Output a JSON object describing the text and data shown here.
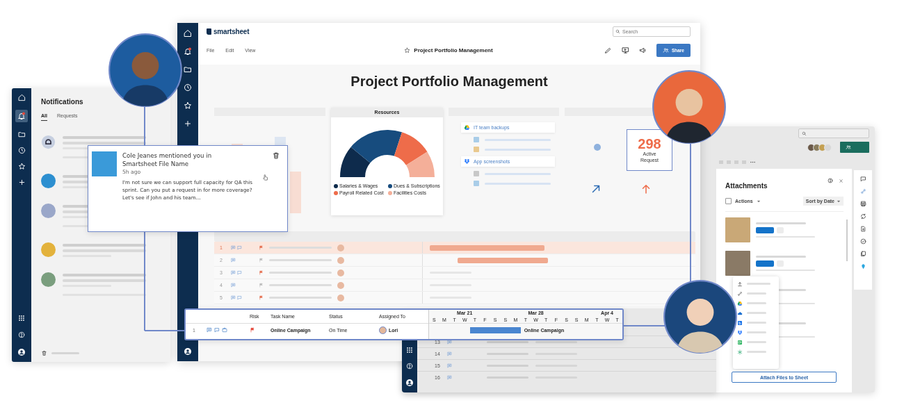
{
  "main": {
    "logo": "smartsheet",
    "search_placeholder": "Search",
    "menu": [
      "File",
      "Edit",
      "View"
    ],
    "sheet_title": "Project Portfolio Management",
    "share_button": "Share",
    "dashboard_title": "Project Portfolio Management",
    "resources": {
      "title": "Resources",
      "legend": [
        {
          "label": "Salaries & Wages",
          "color": "#0e2b4c"
        },
        {
          "label": "Dues & Subscriptions",
          "color": "#174c7e"
        },
        {
          "label": "Payroll Related Cost",
          "color": "#ee6c4a"
        },
        {
          "label": "Facilities Costs",
          "color": "#f4af99"
        }
      ]
    },
    "files": [
      {
        "kind": "gdrive",
        "label": "IT team backups"
      },
      {
        "kind": "dropbox",
        "label": "App screenshots"
      }
    ],
    "sheet_rows": [
      "1",
      "2",
      "3",
      "4",
      "5"
    ]
  },
  "metric": {
    "value": "298",
    "label": "Active Request"
  },
  "notifications": {
    "title": "Notifications",
    "tabs": [
      {
        "label": "All",
        "selected": true
      },
      {
        "label": "Requests",
        "selected": false
      }
    ]
  },
  "notification_card": {
    "title": "Cole Jeanes mentioned you in Smartsheet File Name",
    "time": "5h ago",
    "message": "I'm not sure we can support full capacity for QA this sprint. Can you put a request in for more coverage? Let's see if John and his team..."
  },
  "gantt": {
    "columns": [
      "Risk",
      "Task Name",
      "Status",
      "Assigned To"
    ],
    "weeks": [
      "Mar 21",
      "Mar 28",
      "Apr 4"
    ],
    "days": [
      "S",
      "M",
      "T",
      "W",
      "T",
      "F",
      "S",
      "S",
      "M",
      "T",
      "W",
      "T",
      "F",
      "S",
      "S",
      "M",
      "T",
      "W",
      "T"
    ],
    "row": {
      "number": "1",
      "task": "Online Campaign",
      "status": "On Time",
      "assignee": "Lori",
      "bar_label": "Online Campaign"
    }
  },
  "back_sheet": {
    "rows": [
      "13",
      "14",
      "15",
      "16"
    ]
  },
  "attachments": {
    "title": "Attachments",
    "select_all_checked": false,
    "actions": "Actions",
    "sort": "Sort by Date",
    "attach_button": "Attach Files to Sheet"
  }
}
